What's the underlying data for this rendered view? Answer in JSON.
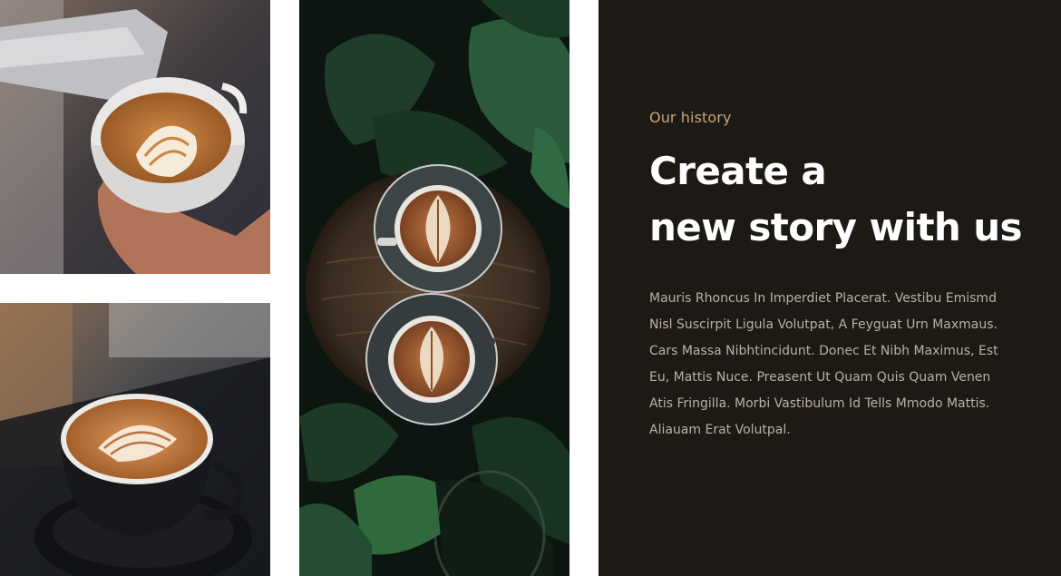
{
  "images": [
    {
      "name": "latte-art-pour-photo"
    },
    {
      "name": "plants-two-cups-photo"
    },
    {
      "name": "dark-cup-latte-photo"
    }
  ],
  "colors": {
    "panel_bg": "#1d1915",
    "accent": "#c9a57a",
    "heading": "#ffffff",
    "body": "#b9b1a8"
  },
  "section": {
    "eyebrow": "Our history",
    "heading_line1": "Create a",
    "heading_line2": "new story with us",
    "body": "Mauris Rhoncus In Imperdiet Placerat. Vestibu Emismd Nisl Suscirpit Ligula Volutpat, A Feyguat Urn Maxmaus. Cars Massa Nibhtincidunt. Donec Et Nibh Maximus, Est Eu, Mattis Nuce. Preasent Ut Quam Quis Quam Venen Atis Fringilla. Morbi Vastibulum Id Tells Mmodo Mattis. Aliauam Erat Volutpal."
  }
}
